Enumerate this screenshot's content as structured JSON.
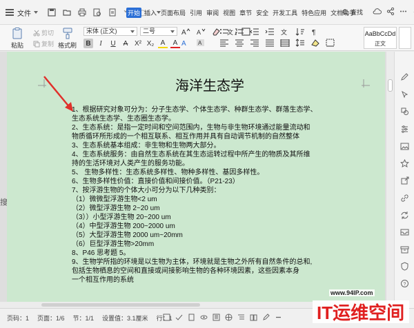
{
  "menubar": {
    "file_label": "文件",
    "tabs": [
      "开始",
      "插入",
      "页面布局",
      "引用",
      "审阅",
      "视图",
      "章节",
      "安全",
      "开发工具",
      "特色应用",
      "文档助手"
    ],
    "search_label": "查找"
  },
  "ribbon": {
    "paste_label": "粘贴",
    "cut_label": "剪切",
    "copy_label": "复制",
    "format_painter_label": "格式刷",
    "font_name": "宋体 (正文)",
    "font_size": "二号",
    "style_preview": "AaBbCcDd",
    "style_name": "正文",
    "format_buttons": [
      "B",
      "I",
      "U",
      "A",
      "X²",
      "X₂",
      "A",
      "A"
    ]
  },
  "document": {
    "title": "海洋生态学",
    "lines": [
      "1、根据研究对象可分为：分子生态学、个体生态学、种群生态学、群落生态学、",
      "生态系统生态学、生态圈生态学。",
      "2、生态系统：是指一定时间和空间范围内，生物与非生物环境通过能量流动和",
      "物质循环所形成的一个相互联系、相互作用并具有自动调节机制的自然整体",
      "3、生态系统基本组成：非生物和生物两大部分。",
      "4、生态系统服务：由自然生态系统在其生态运转过程中所产生的物质及其所维",
      "持的生活环境对人类产生的服务功能。",
      "5、  生物多样性：生态系统多样性、物种多样性、基因多样性。",
      "6、生物多样性价值：直接价值和间接价值。（P21-23）",
      "7、按浮游生物的个体大小可分为以下几种类别：",
      "（1）微微型浮游生物<2 um",
      "（2）微型浮游生物 2~20 um",
      "（3））小型浮游生物 20~200 um",
      "（4）中型浮游生物 200~2000 um",
      "（5）大型浮游生物 2000 um~20mm",
      "（6）巨型浮游生物>20mm",
      "8、P46 思考题 5。",
      "9、生物学所指的环境是以生物为主体，环境就是生物之外所有自然条件的总和,",
      "包括生物栖息的空间和直接或间接影响生物的各种环境因素，这些因素本身",
      "一个相互作用的系统"
    ]
  },
  "statusbar": {
    "page_num": "页码：1",
    "pages": "页面：1/6",
    "section": "节：1/1",
    "setting": "设置值：3.1厘米",
    "row": "行：1"
  },
  "watermark": {
    "url": "www.94IP.com",
    "brand": "IT运维空间"
  },
  "colors": {
    "page_bg": "#cce8cf",
    "active_tab": "#2b6fd6",
    "arrow": "#e0302b",
    "watermark_red": "#e02020"
  }
}
